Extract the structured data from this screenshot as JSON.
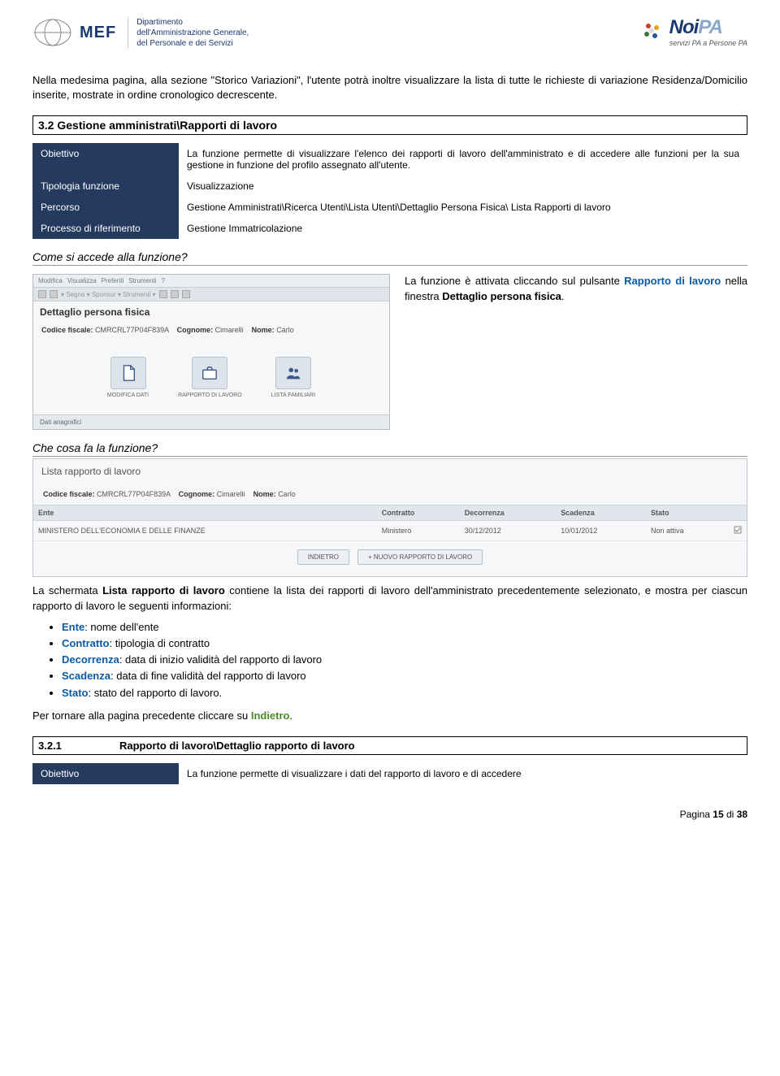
{
  "header": {
    "mef_acronym": "MEF",
    "mef_dept1": "Dipartimento",
    "mef_dept2": "dell'Amministrazione Generale,",
    "mef_dept3": "del Personale e dei Servizi",
    "noipa_name_noi": "Noi",
    "noipa_name_pa": "PA",
    "noipa_sub": "servizi PA a Persone PA"
  },
  "intro": "Nella medesima pagina, alla sezione \"Storico Variazioni\", l'utente potrà inoltre visualizzare la lista di tutte le richieste di variazione Residenza/Domicilio inserite, mostrate in ordine cronologico decrescente.",
  "section32_title": "3.2 Gestione amministrati\\Rapporti di lavoro",
  "info_rows": {
    "r1_label": "Obiettivo",
    "r1_value": "La funzione permette di visualizzare l'elenco dei rapporti di lavoro dell'amministrato e di accedere alle funzioni per la sua gestione in funzione del profilo assegnato all'utente.",
    "r2_label": "Tipologia funzione",
    "r2_value": "Visualizzazione",
    "r3_label": "Percorso",
    "r3_value": "Gestione Amministrati\\Ricerca Utenti\\Lista Utenti\\Dettaglio Persona Fisica\\ Lista Rapporti di lavoro",
    "r4_label": "Processo di riferimento",
    "r4_value": "Gestione Immatricolazione"
  },
  "q1": "Come si accede alla funzione?",
  "q1_text_1": "La funzione è attivata cliccando sul pulsante ",
  "q1_text_blue": "Rapporto di lavoro",
  "q1_text_2": " nella finestra ",
  "q1_text_bold": "Dettaglio persona fisica",
  "q1_text_3": ".",
  "screenshot1": {
    "toolbar1": [
      "Modifica",
      "Visualizza",
      "Preferiti",
      "Strumenti",
      "?"
    ],
    "title": "Dettaglio persona fisica",
    "codice_label": "Codice fiscale:",
    "codice_value": "CMRCRL77P04F839A",
    "cognome_label": "Cognome:",
    "cognome_value": "Cimarelli",
    "nome_label": "Nome:",
    "nome_value": "Carlo",
    "icons": [
      {
        "label": "MODIFICA DATI"
      },
      {
        "label": "RAPPORTO DI LAVORO"
      },
      {
        "label": "LISTA FAMILIARI"
      }
    ],
    "bottom": "Dati anagrafici"
  },
  "q2": "Che cosa fa la funzione?",
  "screenshot2": {
    "title": "Lista rapporto di lavoro",
    "codice_label": "Codice fiscale:",
    "codice_value": "CMRCRL77P04F839A",
    "cognome_label": "Cognome:",
    "cognome_value": "Cimarelli",
    "nome_label": "Nome:",
    "nome_value": "Carlo",
    "headers": [
      "Ente",
      "Contratto",
      "Decorrenza",
      "Scadenza",
      "Stato"
    ],
    "row": [
      "MINISTERO DELL'ECONOMIA E DELLE FINANZE",
      "Ministero",
      "30/12/2012",
      "10/01/2012",
      "Non attiva"
    ],
    "buttons": [
      "INDIETRO",
      "+ NUOVO RAPPORTO DI LAVORO"
    ]
  },
  "p2_1": "La schermata ",
  "p2_bold": "Lista rapporto di lavoro",
  "p2_2": " contiene la lista dei rapporti di lavoro dell'amministrato precedentemente selezionato, e mostra per ciascun rapporto di lavoro le seguenti informazioni:",
  "bullets": [
    {
      "term": "Ente",
      "desc": ": nome dell'ente"
    },
    {
      "term": "Contratto",
      "desc": ": tipologia di contratto"
    },
    {
      "term": "Decorrenza",
      "desc": ": data di inizio validità del rapporto di lavoro"
    },
    {
      "term": "Scadenza",
      "desc": ": data di fine validità del rapporto di lavoro"
    },
    {
      "term": "Stato",
      "desc": ": stato del rapporto di lavoro."
    }
  ],
  "p3_1": "Per tornare alla pagina precedente cliccare su ",
  "p3_green": "Indietro",
  "p3_3": ".",
  "section321_num": "3.2.1",
  "section321_title": "Rapporto di lavoro\\Dettaglio rapporto di lavoro",
  "info2_label": "Obiettivo",
  "info2_value": "La funzione permette di visualizzare i dati del rapporto di lavoro e di accedere",
  "footer_1": "Pagina ",
  "footer_num": "15",
  "footer_2": " di ",
  "footer_total": "38"
}
